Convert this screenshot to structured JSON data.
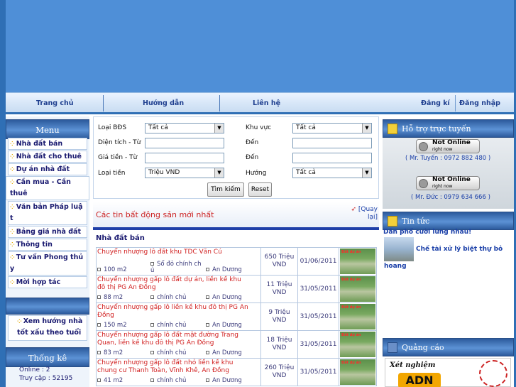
{
  "nav": {
    "home": "Trang chủ",
    "guide": "Hướng dẫn",
    "contact": "Liên hệ",
    "register": "Đăng kí",
    "login": "Đăng nhập"
  },
  "menu": {
    "title": "Menu",
    "items": [
      "Nhà đất bán",
      "Nhà đất cho thuê",
      "Dự án nhà đất",
      "Cần mua - Cần thuê",
      "Văn bản Pháp luật",
      "Bảng giá nhà đất",
      "Thông tin",
      "Tư vấn Phong thủy",
      "Mời hợp tác"
    ],
    "item_lines": [
      [
        "Nhà đất bán"
      ],
      [
        "Nhà đất cho thuê"
      ],
      [
        "Dự án nhà đất"
      ],
      [
        "Cần mua - Cần",
        "thuê"
      ],
      [
        "Văn bản Pháp luậ",
        "t"
      ],
      [
        "Bảng giá nhà đất"
      ],
      [
        "Thông tin"
      ],
      [
        "Tư vấn Phong thủ",
        "y"
      ],
      [
        "Mời hợp tác"
      ]
    ],
    "fengshui": "Xem hướng nhà tốt xấu theo tuổi",
    "fengshui_lines": [
      "Xem hướng nhà",
      "tốt xấu theo tuổi"
    ]
  },
  "stats": {
    "title": "Thống kê",
    "online": "Online : 2",
    "visits": "Truy cập : 52195"
  },
  "search": {
    "type_label": "Loại BĐS",
    "type_value": "Tất cả",
    "area_label": "Khu vực",
    "area_value": "Tất cả",
    "size_label": "Diện tích - Từ",
    "to_label": "Đến",
    "price_label": "Giá tiền - Từ",
    "currency_label": "Loại tiền",
    "currency_value": "Triệu VND",
    "direction_label": "Hướng",
    "direction_value": "Tất cả",
    "search_button": "Tìm kiếm",
    "reset_button": "Reset"
  },
  "listing": {
    "heading": "Các tin bất động sản mới nhất",
    "back": "[Quay lại]",
    "back_lines": [
      "[Quay",
      "lại]"
    ],
    "section": "Nhà đất bán",
    "thumb_text": "Đất dự án",
    "rows": [
      {
        "title": "Chuyển nhượng lô đất khu TDC Văn Cú",
        "title_lines": [
          "Chuyển nhượng lô đất khu TDC Văn Cú"
        ],
        "area": "100 m2",
        "owner": "Sổ đỏ chính ch ủ",
        "owner_lines": [
          "Sổ đỏ chính ch",
          "ủ"
        ],
        "district": "An Dương",
        "price": "650 Triệu VND",
        "price_lines": [
          "650 Triệu",
          "VND"
        ],
        "date": "01/06/2011"
      },
      {
        "title": "Chuyển nhượng gấp lô đất dự án, liền kề khu đô thị PG An Đồng",
        "title_lines": [
          "Chuyển nhượng gấp lô đất dự án, liền kề khu",
          "đô thị PG An Đồng"
        ],
        "area": "88 m2",
        "owner": "chính chủ",
        "owner_lines": [
          "chính chủ"
        ],
        "district": "An Dương",
        "price": "11 Triệu VND",
        "price_lines": [
          "11 Triệu",
          "VND"
        ],
        "date": "31/05/2011"
      },
      {
        "title": "Chuyển nhượng gấp lô liền kề khu đô thị PG An Đồng",
        "title_lines": [
          "Chuyển nhượng gấp lô liền kề khu đô thị PG An",
          "Đồng"
        ],
        "area": "150 m2",
        "owner": "chính chủ",
        "owner_lines": [
          "chính chủ"
        ],
        "district": "An Dương",
        "price": "9 Triệu VND",
        "price_lines": [
          "9 Triệu VND"
        ],
        "date": "31/05/2011"
      },
      {
        "title": "Chuyển nhượng gấp lô đất mặt đường Trang Quan, liền kề khu đô thị PG An Đồng",
        "title_lines": [
          "Chuyển nhượng gấp lô đất mặt đường Trang",
          "Quan, liền kề khu đô thị PG An Đồng"
        ],
        "area": "83 m2",
        "owner": "chính chủ",
        "owner_lines": [
          "chính chủ"
        ],
        "district": "An Dương",
        "price": "18 Triệu VND",
        "price_lines": [
          "18 Triệu",
          "VND"
        ],
        "date": "31/05/2011"
      },
      {
        "title": "Chuyển nhượng gấp lô đất nhỏ liền kề khu chung cư Thanh Toàn, Vĩnh Khê, An Đồng",
        "title_lines": [
          "Chuyển nhượng gấp lô đất nhỏ liền kề khu",
          "chung cư Thanh Toàn, Vĩnh Khê, An Đồng"
        ],
        "area": "41 m2",
        "owner": "chính chủ",
        "owner_lines": [
          "chính chủ"
        ],
        "district": "An Dương",
        "price": "260 Triệu VND",
        "price_lines": [
          "260 Triệu",
          "VND"
        ],
        "date": "31/05/2011"
      }
    ]
  },
  "support": {
    "title": "Hỗ trợ trực tuyến",
    "status": "Not Online",
    "status_sub": "right now",
    "contact1": "( Mr. Tuyến : 0972 882 480 )",
    "contact2": "( Mr. Đức : 0979 634 666 )"
  },
  "news": {
    "title": "Tin tức",
    "item1": "Dân phố cười lưng nhau!",
    "item2": "Chế tài xử lý biệt thự bỏ hoang",
    "item2_lines": [
      "Chế tài xử lý biệt thự bỏ",
      "hoang"
    ]
  },
  "ads": {
    "title": "Quảng cáo",
    "text": "Xét nghiệm",
    "logo": "ADN"
  }
}
